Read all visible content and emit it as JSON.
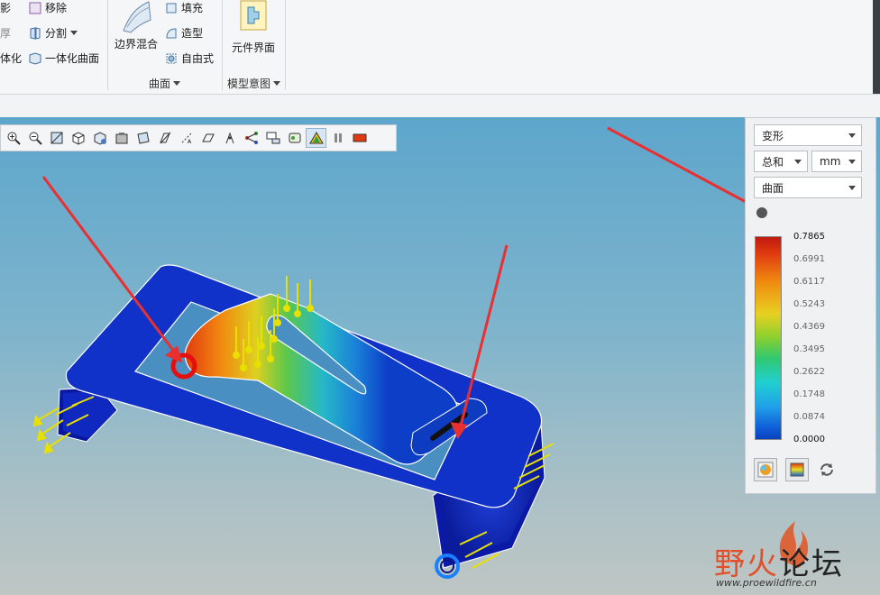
{
  "ribbon": {
    "items": [
      {
        "label": "影"
      },
      {
        "label": "厚"
      },
      {
        "label": "体化"
      },
      {
        "label": "移除"
      },
      {
        "label": "分割"
      },
      {
        "label": "一体化曲面"
      },
      {
        "label": "边界混合"
      },
      {
        "label": "填充"
      },
      {
        "label": "造型"
      },
      {
        "label": "自由式"
      },
      {
        "label": "元件界面"
      }
    ],
    "groups": [
      {
        "label": "曲面"
      },
      {
        "label": "模型意图"
      }
    ]
  },
  "view_toolbar": {
    "icons": [
      "zoom-in-icon",
      "zoom-out-icon",
      "refit-icon",
      "view-orient-icon",
      "saved-views-icon",
      "display-style-icon",
      "perspective-icon",
      "datum-display-icon",
      "datum-axis-icon",
      "datum-plane-icon",
      "datum-point-icon",
      "spin-center-icon",
      "annotation-icon",
      "appearance-icon",
      "results-animation-icon",
      "pause-icon",
      "legend-icon"
    ]
  },
  "results_panel": {
    "quantity": "变形",
    "component": "总和",
    "units": "mm",
    "display": "曲面",
    "legend_values": [
      "0.7865",
      "0.6991",
      "0.6117",
      "0.5243",
      "0.4369",
      "0.3495",
      "0.2622",
      "0.1748",
      "0.0874",
      "0.0000"
    ]
  },
  "watermark": {
    "name": "野火论坛",
    "url": "www.proewildfire.cn"
  }
}
